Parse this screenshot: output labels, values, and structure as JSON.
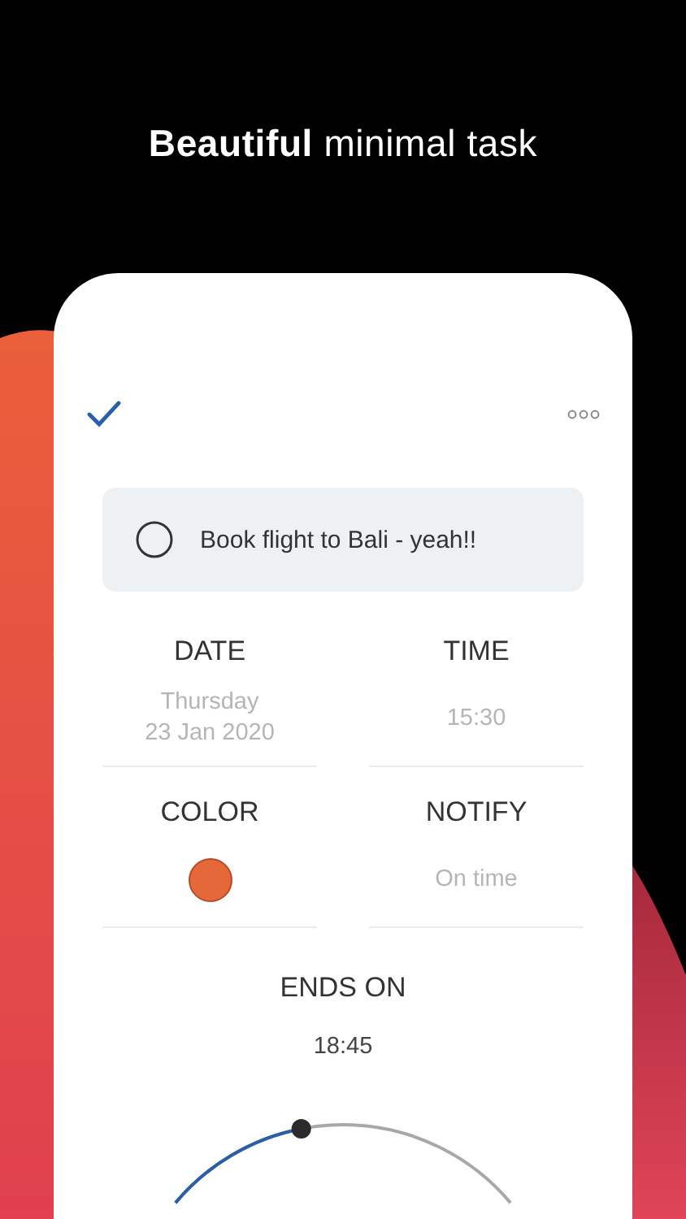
{
  "headline": "**Beautiful** minimal task",
  "task": {
    "title": "Book flight to Bali - yeah!!",
    "done": false
  },
  "fields": [
    {
      "label": "DATE",
      "kind": "text",
      "values": [
        "Thursday",
        "23 Jan 2020"
      ]
    },
    {
      "label": "TIME",
      "kind": "text",
      "values": [
        "15:30"
      ]
    },
    {
      "label": "COLOR",
      "kind": "color",
      "color": "#e5683a"
    },
    {
      "label": "NOTIFY",
      "kind": "text",
      "values": [
        "On time"
      ]
    }
  ],
  "ends_on": {
    "label": "ENDS ON",
    "value": "18:45",
    "level": 0.39
  }
}
